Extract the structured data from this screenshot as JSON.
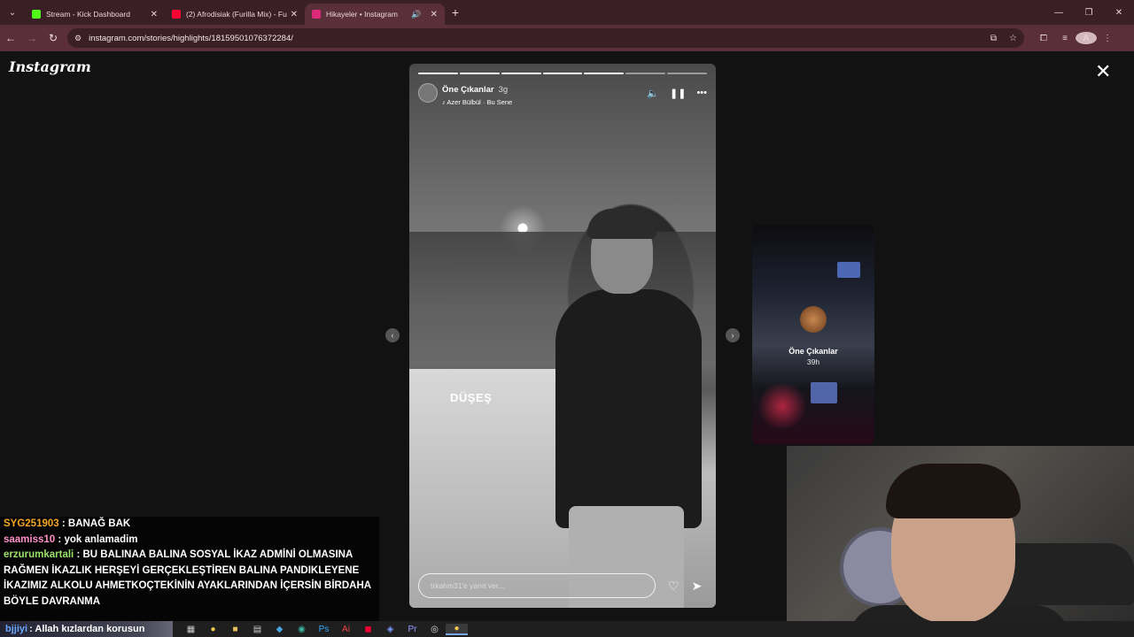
{
  "browser": {
    "tabs": [
      {
        "title": "Stream - Kick Dashboard",
        "favicon_color": "#53fc18",
        "active": false
      },
      {
        "title": "(2) Afrodisiak (Furilla Mix) - Fur",
        "favicon_color": "#ff0033",
        "active": false
      },
      {
        "title": "Hikayeler • Instagram",
        "favicon_color": "#dd2a7b",
        "active": true
      }
    ],
    "url": "instagram.com/stories/highlights/18159501076372284/"
  },
  "instagram": {
    "logo": "Instagram",
    "story": {
      "username": "Öne Çıkanlar",
      "time": "3g",
      "music": "Azer Bülbül · Bu Sene",
      "overlay_text": "DÜŞEŞ",
      "reply_placeholder": "trkahm31'e yanıt ver...",
      "progress_total": 7,
      "progress_done": 5
    },
    "next_story": {
      "name": "Öne Çıkanlar",
      "time": "39h"
    }
  },
  "chat": [
    {
      "user": "SYG251903",
      "color": "#f5a623",
      "message": "BANAĞ BAK"
    },
    {
      "user": "saamiss10",
      "color": "#ff8fc7",
      "message": "yok anlamadim"
    },
    {
      "user": "erzurumkartali",
      "color": "#9be26b",
      "message": "BU BALINAA BALINA SOSYAL İKAZ ADMİNİ OLMASINA RAĞMEN İKAZLIK HERŞEYİ GERÇEKLEŞTİREN BALINA PANDIKLEYENE İKAZIMIZ ALKOLU AHMETKOÇTEKİNİN AYAKLARINDAN İÇERSİN BİRDAHA BÖYLE DAVRANMA"
    }
  ],
  "taskbar": {
    "widget_user": "bjjiyi",
    "widget_text": ": Allah kızlardan korusun"
  }
}
